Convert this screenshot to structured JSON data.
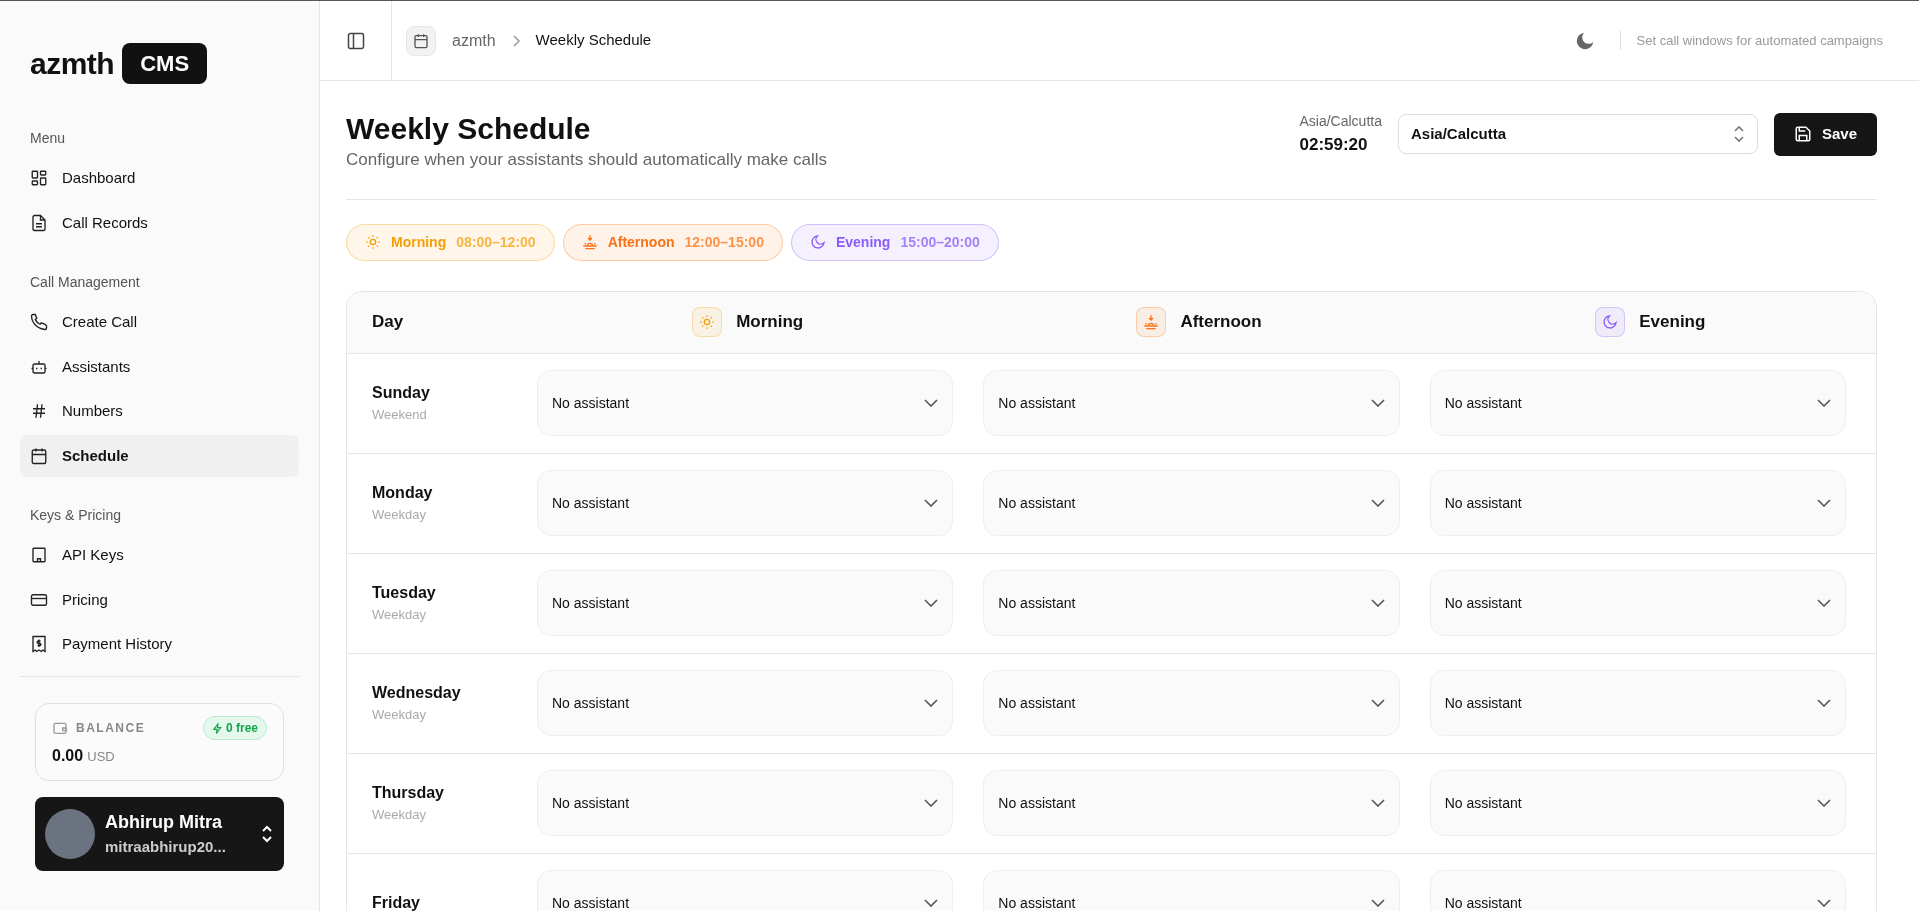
{
  "sidebar": {
    "logo": {
      "text": "azmth",
      "badge": "CMS"
    },
    "sections": [
      {
        "label": "Menu",
        "items": [
          {
            "label": "Dashboard",
            "kind": "grid",
            "selected": false
          },
          {
            "label": "Call Records",
            "kind": "file",
            "selected": false
          }
        ]
      },
      {
        "label": "Call Management",
        "items": [
          {
            "label": "Create Call",
            "kind": "phone",
            "selected": false
          },
          {
            "label": "Assistants",
            "kind": "bot",
            "selected": false
          },
          {
            "label": "Numbers",
            "kind": "hash",
            "selected": false
          },
          {
            "label": "Schedule",
            "kind": "calendar",
            "selected": true
          }
        ]
      },
      {
        "label": "Keys & Pricing",
        "items": [
          {
            "label": "API Keys",
            "kind": "building",
            "selected": false
          },
          {
            "label": "Pricing",
            "kind": "card",
            "selected": false
          },
          {
            "label": "Payment History",
            "kind": "receipt",
            "selected": false
          }
        ]
      }
    ],
    "balance": {
      "label": "BALANCE",
      "free": "0 free",
      "amount": "0.00",
      "currency": "USD"
    },
    "user": {
      "name": "Abhirup Mitra",
      "email": "mitraabhirup20..."
    }
  },
  "header": {
    "breadcrumb": [
      "azmth",
      "Weekly Schedule"
    ],
    "hint": "Set call windows for automated campaigns"
  },
  "page": {
    "title": "Weekly Schedule",
    "subtitle": "Configure when your assistants should automatically make calls",
    "timezone_label": "Asia/Calcutta",
    "clock": "02:59:20",
    "timezone_select": "Asia/Calcutta",
    "save_button": "Save"
  },
  "periods": [
    {
      "kind": "morning",
      "label": "Morning",
      "range": "08:00–12:00",
      "color": "#f59e0b"
    },
    {
      "kind": "afternoon",
      "label": "Afternoon",
      "range": "12:00–15:00",
      "color": "#f97316"
    },
    {
      "kind": "evening",
      "label": "Evening",
      "range": "15:00–20:00",
      "color": "#8b5cf6"
    }
  ],
  "table": {
    "day_column": "Day",
    "columns": [
      {
        "kind": "morning",
        "label": "Morning"
      },
      {
        "kind": "afternoon",
        "label": "Afternoon"
      },
      {
        "kind": "evening",
        "label": "Evening"
      }
    ],
    "rows": [
      {
        "day": "Sunday",
        "type": "Weekend",
        "slots": [
          "No assistant",
          "No assistant",
          "No assistant"
        ]
      },
      {
        "day": "Monday",
        "type": "Weekday",
        "slots": [
          "No assistant",
          "No assistant",
          "No assistant"
        ]
      },
      {
        "day": "Tuesday",
        "type": "Weekday",
        "slots": [
          "No assistant",
          "No assistant",
          "No assistant"
        ]
      },
      {
        "day": "Wednesday",
        "type": "Weekday",
        "slots": [
          "No assistant",
          "No assistant",
          "No assistant"
        ]
      },
      {
        "day": "Thursday",
        "type": "Weekday",
        "slots": [
          "No assistant",
          "No assistant",
          "No assistant"
        ]
      },
      {
        "day": "Friday",
        "slots": [
          "No assistant",
          "No assistant",
          "No assistant"
        ]
      }
    ]
  }
}
